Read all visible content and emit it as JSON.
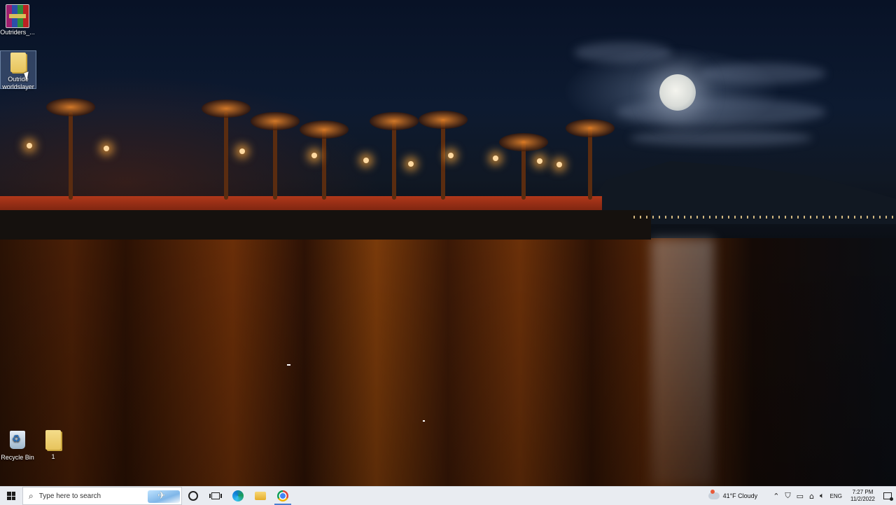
{
  "desktop": {
    "icons": [
      {
        "label": "Outriders_...",
        "type": "winrar-archive-icon"
      },
      {
        "label": "Outriders worldslayer",
        "type": "folder-icon"
      },
      {
        "label": "Recycle Bin",
        "type": "recycle-bin-icon"
      },
      {
        "label": "1",
        "type": "folder-icon"
      }
    ],
    "selected_icon_partial_label_line1": "Outride",
    "selected_icon_partial_label_line2": "worldslayer"
  },
  "taskbar": {
    "search_placeholder": "Type here to search",
    "apps": [
      "task-view-icon",
      "edge-icon",
      "file-explorer-icon",
      "chrome-icon"
    ],
    "active_app": "chrome",
    "accent_color": "#4a7fd1"
  },
  "tray": {
    "weather": "41°F Cloudy",
    "language": "ENG",
    "time": "7:27 PM",
    "date": "11/2/2022"
  }
}
